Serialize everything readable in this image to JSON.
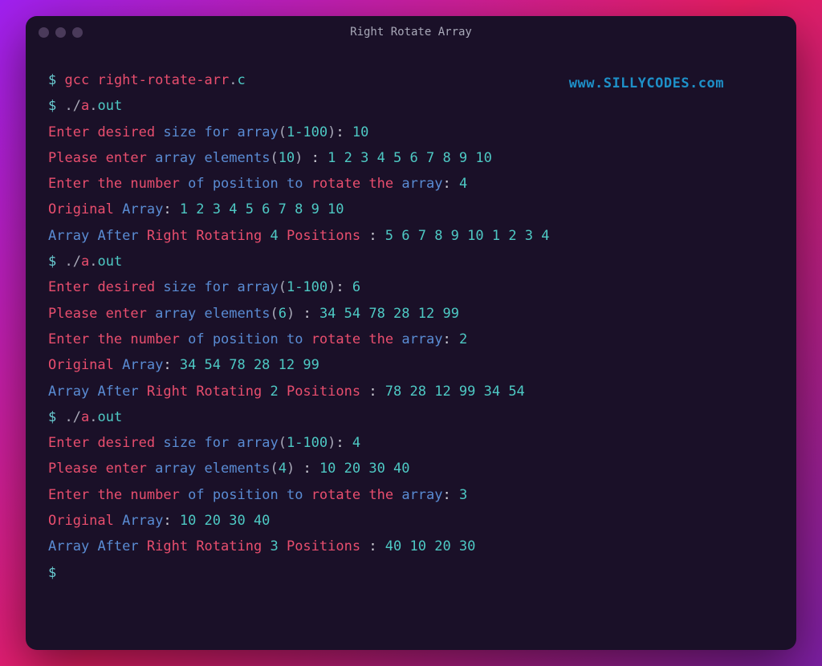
{
  "window": {
    "title": "Right Rotate Array"
  },
  "watermark": "www.SILLYCODES.com",
  "prompt": "$",
  "commands": {
    "gcc": "gcc",
    "file": "right-rotate-arr",
    "ext": "c",
    "dot": ".",
    "slash": "/",
    "a": "a",
    "out": "out"
  },
  "text": {
    "enter": "Enter",
    "desired": "desired",
    "size": "size",
    "for": "for",
    "array": "array",
    "please": "Please",
    "enter2": "enter",
    "elements": "elements",
    "the": "the",
    "number": "number",
    "of": "of",
    "position": "position",
    "to": "to",
    "rotate": "rotate",
    "original": "Original",
    "array_cap": "Array",
    "after": "After",
    "right": "Right",
    "rotating": "Rotating",
    "positions": "Positions",
    "range": "1-100",
    "colon": ":",
    "colonsp": " : "
  },
  "runs": [
    {
      "size": "10",
      "input": "1 2 3 4 5 6 7 8 9 10",
      "rot": "4",
      "orig": "1 2 3 4 5 6 7 8 9 10",
      "result": "5 6 7 8 9 10 1 2 3 4"
    },
    {
      "size": "6",
      "input": "34 54 78 28 12 99",
      "rot": "2",
      "orig": "34 54 78 28 12 99",
      "result": "78 28 12 99 34 54"
    },
    {
      "size": "4",
      "input": "10 20 30 40",
      "rot": "3",
      "orig": "10 20 30 40",
      "result": "40 10 20 30"
    }
  ]
}
